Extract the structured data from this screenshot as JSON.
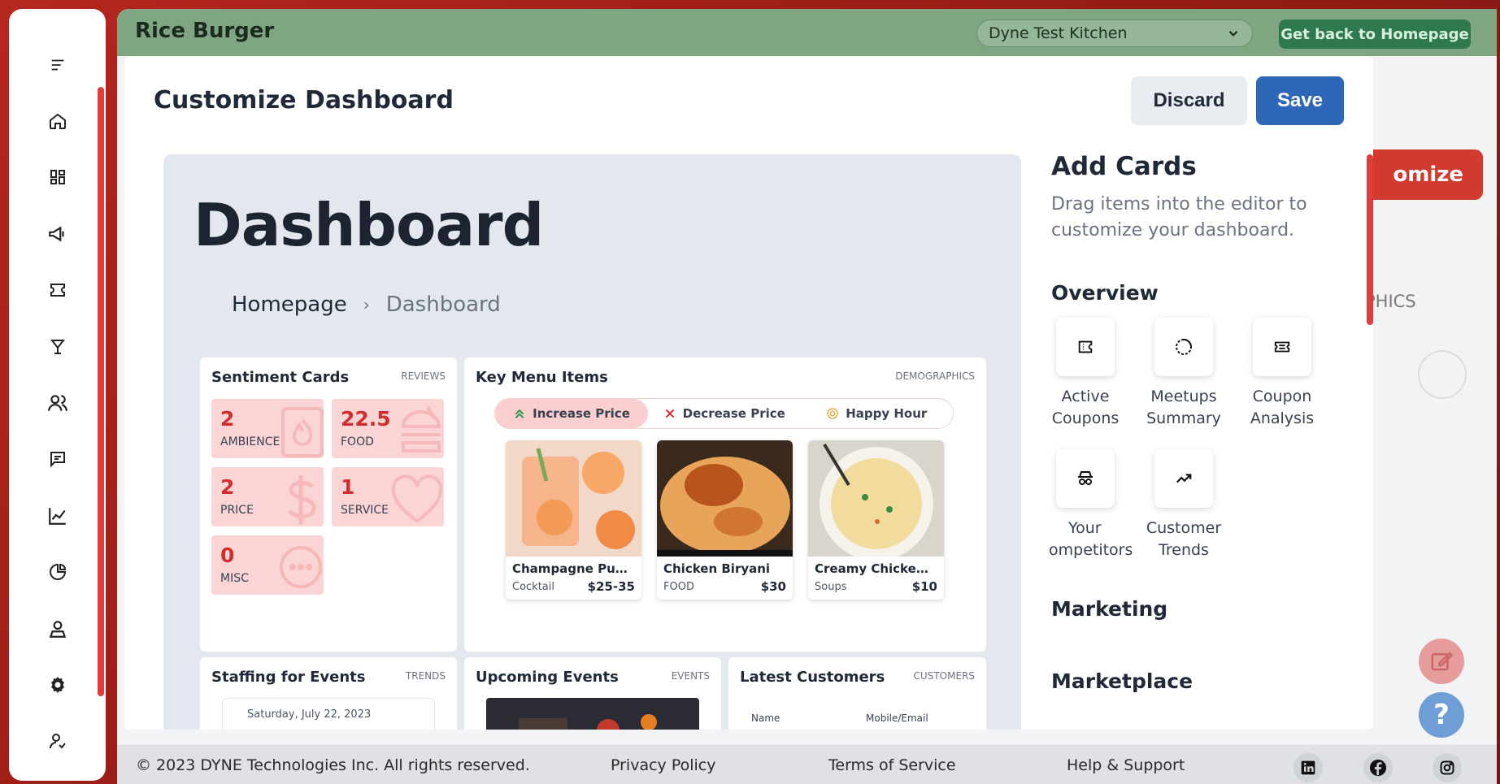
{
  "app": {
    "title": "Rice Burger",
    "kitchen": "Dyne Test Kitchen",
    "home_button": "Get back to Homepage",
    "customize_button": "omize",
    "tab_fragment": "PHICS"
  },
  "sidebar": {
    "items": [
      "menu-icon",
      "home-icon",
      "dashboard-icon",
      "megaphone-icon",
      "ticket-icon",
      "cocktail-icon",
      "users-icon",
      "chat-icon",
      "chart-icon",
      "pie-icon",
      "profile-icon",
      "settings-icon",
      "account-icon"
    ]
  },
  "footer": {
    "copyright": "© 2023 DYNE Technologies Inc. All rights reserved.",
    "privacy": "Privacy Policy",
    "terms": "Terms of Service",
    "help": "Help & Support"
  },
  "modal": {
    "title": "Customize Dashboard",
    "discard": "Discard",
    "save": "Save",
    "editor": {
      "dashboard_title": "Dashboard",
      "breadcrumb": {
        "home": "Homepage",
        "separator": "›",
        "current": "Dashboard"
      },
      "sentiment": {
        "title": "Sentiment Cards",
        "tag": "REVIEWS",
        "tiles": [
          {
            "value": "2",
            "label": "AMBIENCE"
          },
          {
            "value": "22.5",
            "label": "FOOD"
          },
          {
            "value": "2",
            "label": "PRICE"
          },
          {
            "value": "1",
            "label": "SERVICE"
          },
          {
            "value": "0",
            "label": "MISC"
          }
        ]
      },
      "key_menu": {
        "title": "Key Menu Items",
        "tag": "DEMOGRAPHICS",
        "options": [
          "Increase Price",
          "Decrease Price",
          "Happy Hour"
        ],
        "dishes": [
          {
            "name": "Champagne Punch",
            "category": "Cocktail",
            "price": "$25-35"
          },
          {
            "name": "Chicken Biryani",
            "category": "FOOD",
            "price": "$30"
          },
          {
            "name": "Creamy Chicken…",
            "category": "Soups",
            "price": "$10"
          }
        ]
      },
      "staffing": {
        "title": "Staffing for Events",
        "tag": "TRENDS",
        "date": "Saturday, July 22, 2023"
      },
      "events": {
        "title": "Upcoming Events",
        "tag": "EVENTS"
      },
      "customers": {
        "title": "Latest Customers",
        "tag": "CUSTOMERS",
        "col_name": "Name",
        "col_contact": "Mobile/Email"
      }
    },
    "panel": {
      "title": "Add Cards",
      "description": "Drag items into the editor to customize your dashboard.",
      "overview_label": "Overview",
      "overview_cards": [
        {
          "line1": "Active",
          "line2": "Coupons",
          "icon": "ticket-icon"
        },
        {
          "line1": "Meetups",
          "line2": "Summary",
          "icon": "loader-icon"
        },
        {
          "line1": "Coupon",
          "line2": "Analysis",
          "icon": "coupon-icon"
        },
        {
          "line1": "Your",
          "line2": "ompetitors",
          "icon": "spy-icon"
        },
        {
          "line1": "Customer",
          "line2": "Trends",
          "icon": "trend-icon"
        }
      ],
      "marketing_label": "Marketing",
      "marketplace_label": "Marketplace"
    }
  },
  "colors": {
    "accent_red": "#d23a2f",
    "save_blue": "#2f67b8",
    "topbar_green": "#7fa583",
    "tile_pink": "#fbd5d5"
  }
}
